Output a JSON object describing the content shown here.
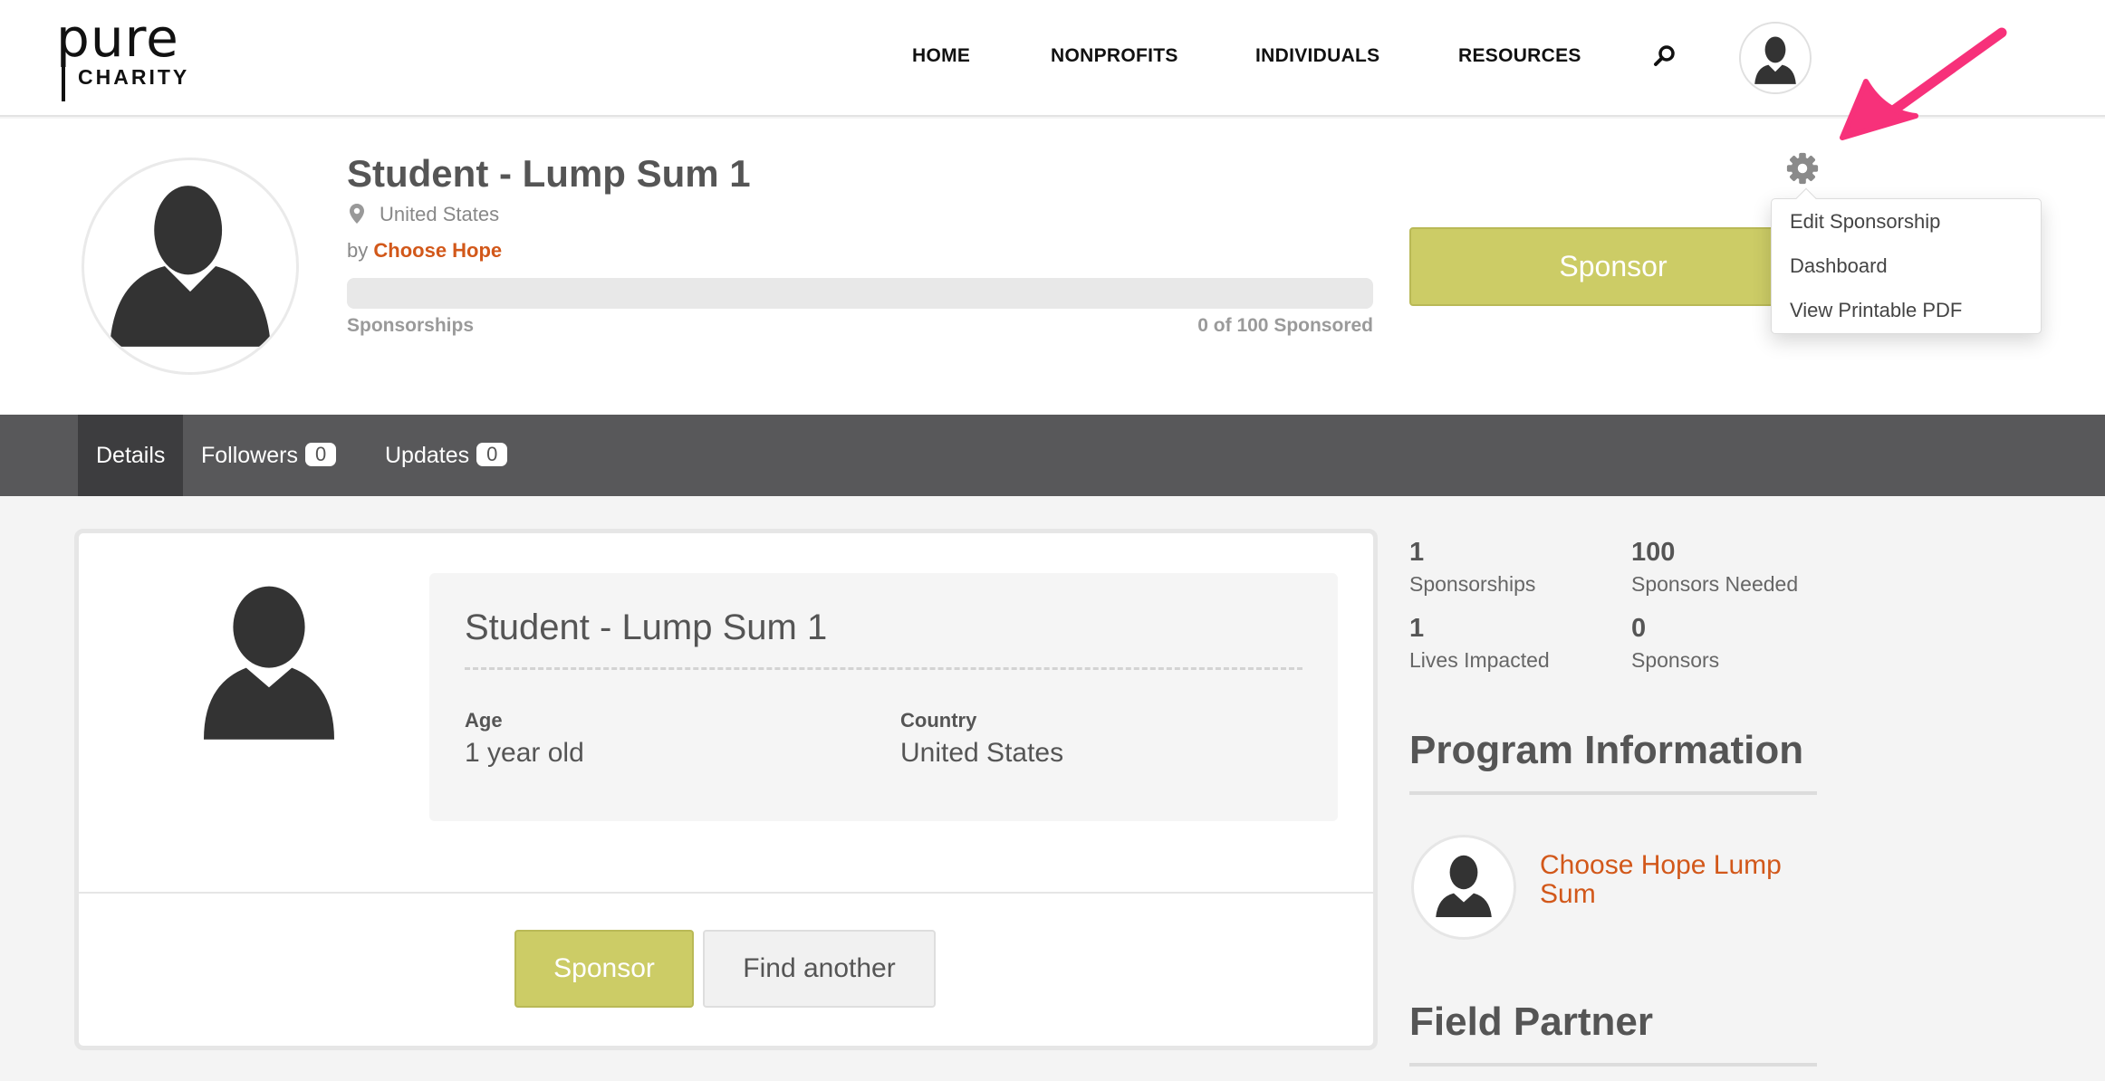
{
  "logo": {
    "line1": "pure",
    "line2": "CHARITY"
  },
  "nav": {
    "items": [
      "HOME",
      "NONPROFITS",
      "INDIVIDUALS",
      "RESOURCES"
    ]
  },
  "profile": {
    "title": "Student - Lump Sum 1",
    "location": "United States",
    "by_prefix": "by",
    "by_org": "Choose Hope",
    "progress_fraction": 0,
    "progress_label": "Sponsorships",
    "progress_count": "0 of 100 Sponsored",
    "sponsor_button": "Sponsor"
  },
  "settings_menu": {
    "items": [
      "Edit Sponsorship",
      "Dashboard",
      "View Printable PDF"
    ]
  },
  "tabs": [
    {
      "label": "Details"
    },
    {
      "label": "Followers",
      "count": "0"
    },
    {
      "label": "Updates",
      "count": "0"
    }
  ],
  "details": {
    "heading": "Student - Lump Sum 1",
    "age_label": "Age",
    "age_value": "1 year old",
    "country_label": "Country",
    "country_value": "United States",
    "sponsor_button": "Sponsor",
    "find_button": "Find another"
  },
  "stats": [
    {
      "value": "1",
      "label": "Sponsorships"
    },
    {
      "value": "100",
      "label": "Sponsors Needed"
    },
    {
      "value": "1",
      "label": "Lives Impacted"
    },
    {
      "value": "0",
      "label": "Sponsors"
    }
  ],
  "program": {
    "heading": "Program Information",
    "link": "Choose Hope Lump Sum"
  },
  "field_partner": {
    "heading": "Field Partner"
  },
  "colors": {
    "accent_orange": "#d2581a",
    "sponsor_green": "#cccc66",
    "tabbar": "#58585a",
    "arrow_pink": "#f7317a"
  }
}
